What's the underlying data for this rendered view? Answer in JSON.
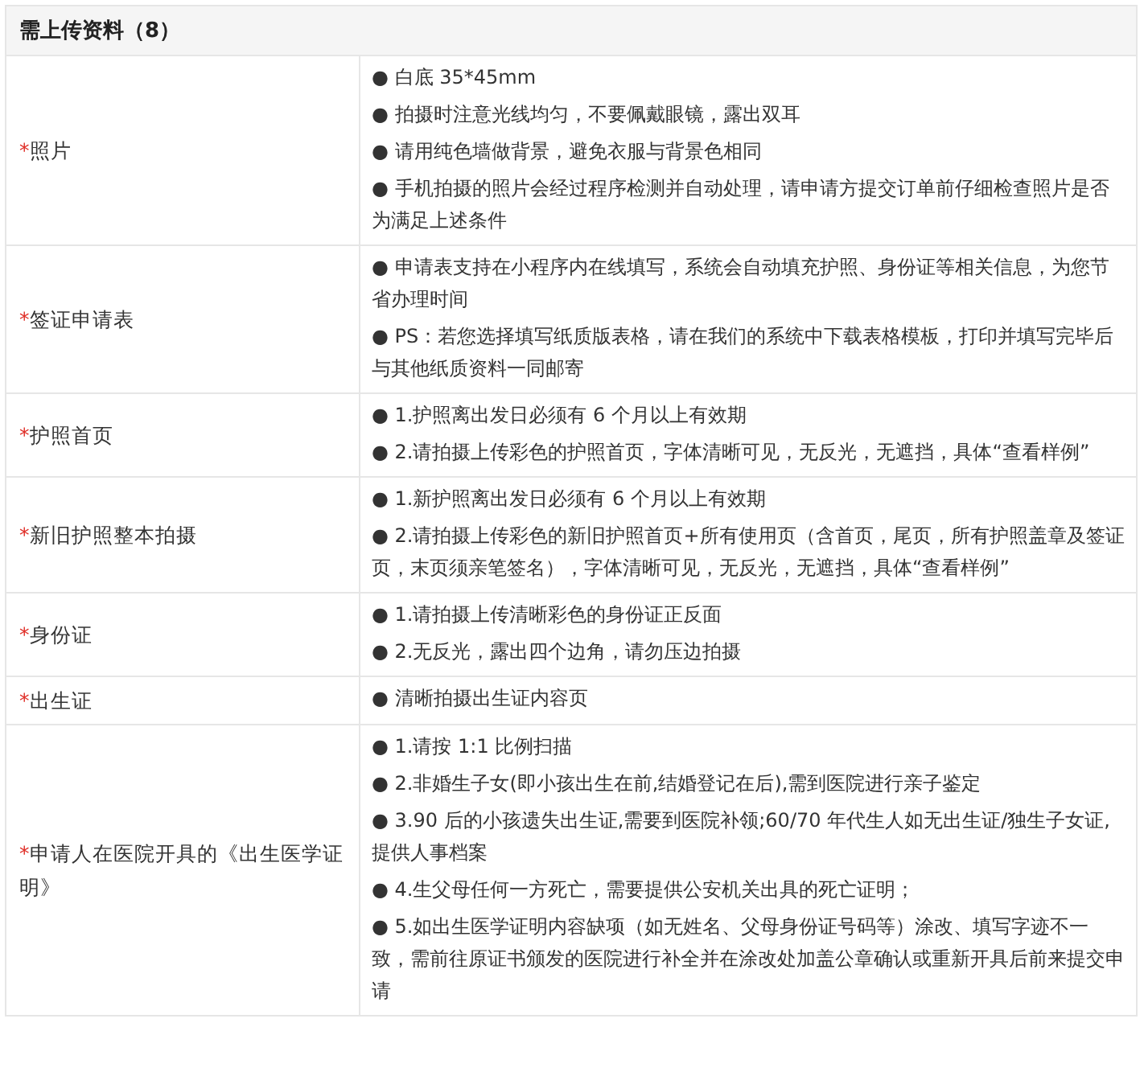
{
  "section": {
    "title": "需上传资料（8）"
  },
  "required_mark": "*",
  "rows": [
    {
      "label": "照片",
      "required": true,
      "items": [
        "● 白底  35*45mm",
        "● 拍摄时注意光线均匀，不要佩戴眼镜，露出双耳",
        "● 请用纯色墙做背景，避免衣服与背景色相同",
        "● 手机拍摄的照片会经过程序检测并自动处理，请申请方提交订单前仔细检查照片是否为满足上述条件"
      ]
    },
    {
      "label": "签证申请表",
      "required": true,
      "items": [
        "● 申请表支持在小程序内在线填写，系统会自动填充护照、身份证等相关信息，为您节省办理时间",
        "● PS：若您选择填写纸质版表格，请在我们的系统中下载表格模板，打印并填写完毕后与其他纸质资料一同邮寄"
      ]
    },
    {
      "label": "护照首页",
      "required": true,
      "items": [
        "● 1.护照离出发日必须有 6 个月以上有效期",
        "● 2.请拍摄上传彩色的护照首页，字体清晰可见，无反光，无遮挡，具体“查看样例”"
      ]
    },
    {
      "label": "新旧护照整本拍摄",
      "required": true,
      "items": [
        "● 1.新护照离出发日必须有 6 个月以上有效期",
        "● 2.请拍摄上传彩色的新旧护照首页+所有使用页（含首页，尾页，所有护照盖章及签证页，末页须亲笔签名），字体清晰可见，无反光，无遮挡，具体“查看样例”"
      ]
    },
    {
      "label": "身份证",
      "required": true,
      "items": [
        "● 1.请拍摄上传清晰彩色的身份证正反面",
        "● 2.无反光，露出四个边角，请勿压边拍摄"
      ]
    },
    {
      "label": "出生证",
      "required": true,
      "items": [
        "● 清晰拍摄出生证内容页"
      ]
    },
    {
      "label": "申请人在医院开具的《出生医学证明》",
      "required": true,
      "items": [
        "● 1.请按 1:1 比例扫描",
        "● 2.非婚生子女(即小孩出生在前,结婚登记在后),需到医院进行亲子鉴定",
        "● 3.90 后的小孩遗失出生证,需要到医院补领;60/70 年代生人如无出生证/独生子女证,提供人事档案",
        "● 4.生父母任何一方死亡，需要提供公安机关出具的死亡证明；",
        "● 5.如出生医学证明内容缺项（如无姓名、父母身份证号码等）涂改、填写字迹不一致，需前往原证书颁发的医院进行补全并在涂改处加盖公章确认或重新开具后前来提交申请"
      ]
    }
  ]
}
